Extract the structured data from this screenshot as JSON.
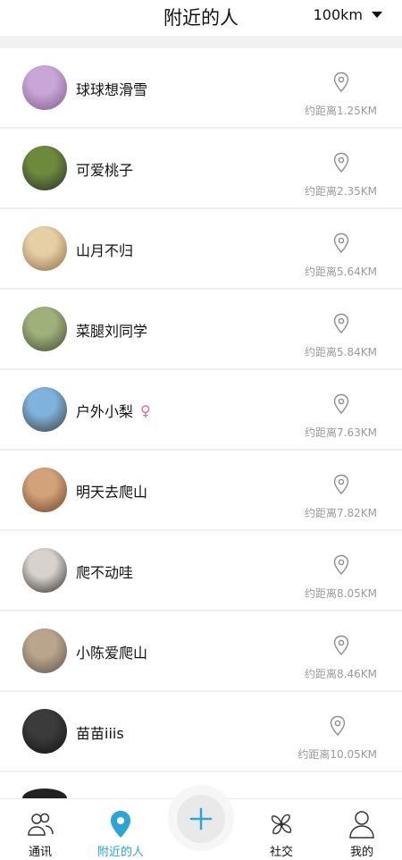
{
  "header": {
    "title": "附近的人",
    "distance_filter": "100km"
  },
  "users": [
    {
      "name": "球球想滑雪",
      "distance": "约距离1.25KM",
      "gender": "",
      "avatar_colors": [
        "#c9a6d8",
        "#7a5a8c"
      ]
    },
    {
      "name": "可爱桃子",
      "distance": "约距离2.35KM",
      "gender": "",
      "avatar_colors": [
        "#6d8a3c",
        "#2b2b2b"
      ]
    },
    {
      "name": "山月不归",
      "distance": "约距离5.64KM",
      "gender": "",
      "avatar_colors": [
        "#e6cfa4",
        "#8a6a45"
      ]
    },
    {
      "name": "菜腿刘同学",
      "distance": "约距离5.84KM",
      "gender": "",
      "avatar_colors": [
        "#9fb07a",
        "#3f4a33"
      ]
    },
    {
      "name": "户外小梨",
      "distance": "约距离7.63KM",
      "gender": "♀",
      "avatar_colors": [
        "#7fb2dc",
        "#3a3a3a"
      ]
    },
    {
      "name": "明天去爬山",
      "distance": "约距离7.82KM",
      "gender": "",
      "avatar_colors": [
        "#d2a27a",
        "#6b3f25"
      ]
    },
    {
      "name": "爬不动哇",
      "distance": "约距离8.05KM",
      "gender": "",
      "avatar_colors": [
        "#d9d2cc",
        "#2a2a2a"
      ]
    },
    {
      "name": "小陈爱爬山",
      "distance": "约距离8.46KM",
      "gender": "",
      "avatar_colors": [
        "#b9a58c",
        "#5b5247"
      ]
    },
    {
      "name": "苗苗iiis",
      "distance": "约距离10.05KM",
      "gender": "",
      "avatar_colors": [
        "#3b3b3b",
        "#111111"
      ]
    }
  ],
  "tabbar": {
    "items": [
      {
        "label": "通讯",
        "icon": "contacts-icon",
        "active": false
      },
      {
        "label": "附近的人",
        "icon": "location-pin-icon",
        "active": true
      },
      {
        "label": "",
        "icon": "plus-icon",
        "active": false
      },
      {
        "label": "社交",
        "icon": "pinwheel-icon",
        "active": false
      },
      {
        "label": "我的",
        "icon": "profile-icon",
        "active": false
      }
    ]
  },
  "colors": {
    "accent": "#29a5d8",
    "muted": "#9a9a9a",
    "female": "#e06a93"
  }
}
